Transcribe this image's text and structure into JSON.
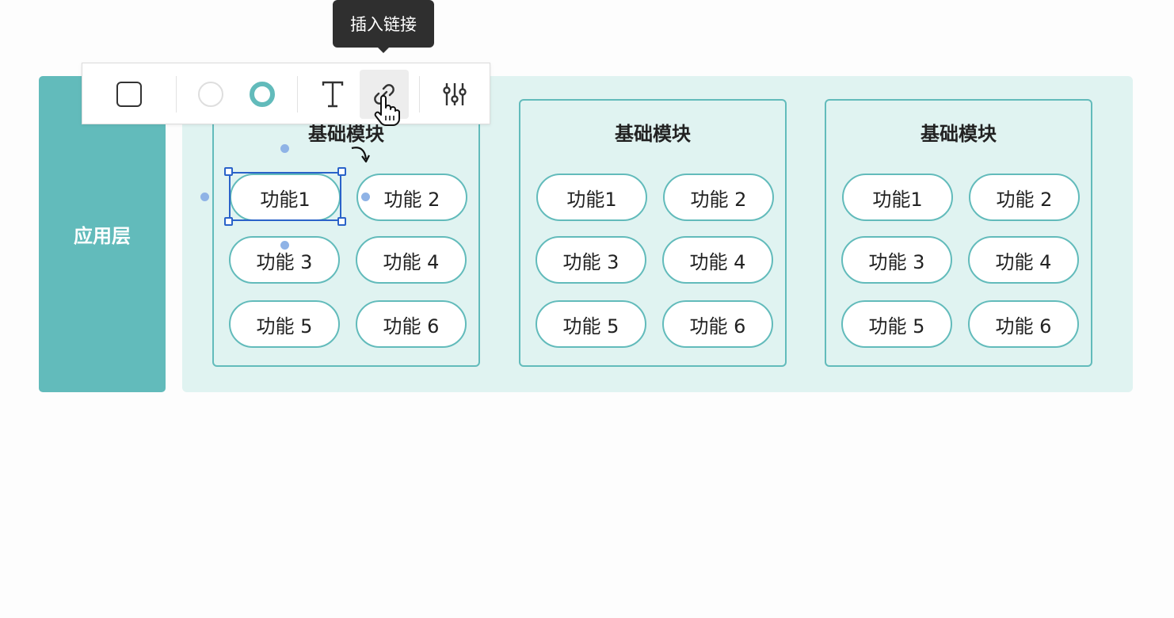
{
  "layer": {
    "label": "应用层"
  },
  "modules": [
    {
      "title": "基础模块",
      "functions": [
        "功能1",
        "功能 2",
        "功能 3",
        "功能 4",
        "功能 5",
        "功能 6"
      ]
    },
    {
      "title": "基础模块",
      "functions": [
        "功能1",
        "功能 2",
        "功能 3",
        "功能 4",
        "功能 5",
        "功能 6"
      ]
    },
    {
      "title": "基础模块",
      "functions": [
        "功能1",
        "功能 2",
        "功能 3",
        "功能 4",
        "功能 5",
        "功能 6"
      ]
    }
  ],
  "toolbar": {
    "tooltip": "插入链接",
    "icons": [
      "square-shape-icon",
      "fill-color-icon",
      "stroke-color-icon",
      "text-icon",
      "link-icon",
      "adjust-icon"
    ]
  },
  "colors": {
    "accent": "#62bbbb",
    "layer_background": "#e0f3f1",
    "selection": "#2a62c9",
    "tooltip_background": "#2f2f2f"
  }
}
